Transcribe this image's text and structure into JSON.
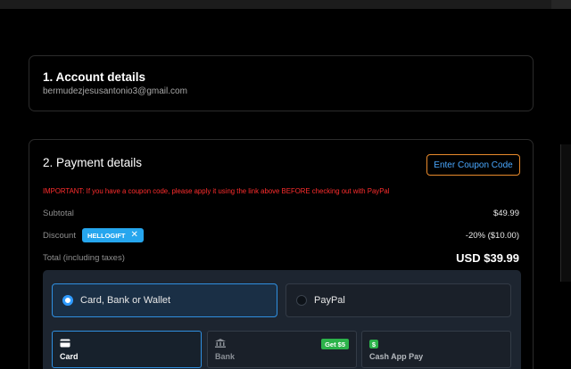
{
  "account": {
    "title": "1. Account details",
    "email": "bermudezjesusantonio3@gmail.com"
  },
  "payment": {
    "title": "2. Payment details",
    "coupon_button": "Enter Coupon Code",
    "important_notice": "IMPORTANT: If you have a coupon code, please apply it using the link above BEFORE checking out with PayPal",
    "subtotal_label": "Subtotal",
    "subtotal_value": "$49.99",
    "discount_label": "Discount",
    "discount_code": "HELLOGIFT",
    "discount_remove": "✕",
    "discount_value": "-20% ($10.00)",
    "total_label": "Total (including taxes)",
    "total_value": "USD $39.99",
    "methods": [
      {
        "label": "Card, Bank or Wallet",
        "selected": true
      },
      {
        "label": "PayPal",
        "selected": false
      }
    ],
    "sub_methods": [
      {
        "label": "Card",
        "icon": "card-icon",
        "selected": true
      },
      {
        "label": "Bank",
        "icon": "bank-icon",
        "badge": "Get $5"
      },
      {
        "label": "Cash App Pay",
        "icon": "cash-app-icon"
      }
    ]
  },
  "colors": {
    "accent_blue": "#2f8fe0",
    "coupon_border": "#e88a2c",
    "warning_red": "#ff2d2d",
    "promo_blue": "#26a6ee",
    "badge_green": "#2cb34a"
  }
}
